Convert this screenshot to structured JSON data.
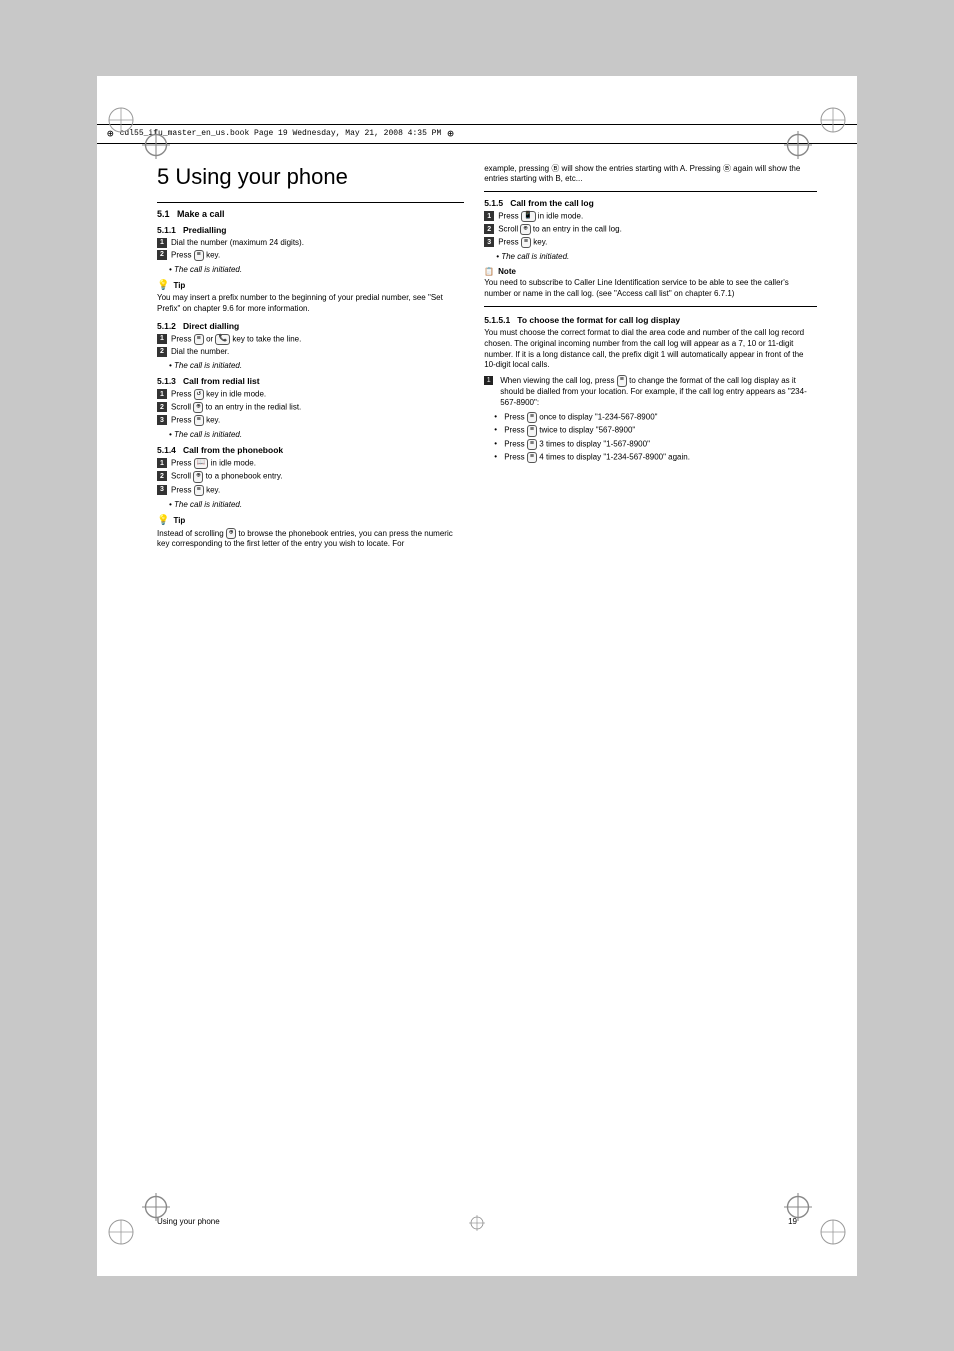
{
  "page": {
    "header_filename": "cdl55_ifu_master_en_us.book   Page 19   Wednesday, May 21, 2008   4:35 PM",
    "chapter_num": "5",
    "chapter_title": "Using your phone",
    "footer_left": "Using your phone",
    "footer_right": "19"
  },
  "left": {
    "section_1_label": "5.1",
    "section_1_title": "Make a call",
    "section_11_label": "5.1.1",
    "section_11_title": "Predialling",
    "section_11_steps": [
      "Dial the number (maximum 24 digits).",
      "Press ≡ key."
    ],
    "section_11_italic": "The call is initiated.",
    "tip1_label": "Tip",
    "tip1_text": "You may insert a prefix number to the beginning of your predial number, see \"Set Prefix\" on chapter 9.6 for more information.",
    "section_12_label": "5.1.2",
    "section_12_title": "Direct dialling",
    "section_12_steps": [
      "Press ≡ or 📞 key to take the line.",
      "Dial the number."
    ],
    "section_12_italic": "The call is initiated.",
    "section_13_label": "5.1.3",
    "section_13_title": "Call from redial list",
    "section_13_steps": [
      "Press ↺ key in idle mode.",
      "Scroll ⊕ to an entry in the redial list.",
      "Press ≡ key."
    ],
    "section_13_italic": "The call is initiated.",
    "section_14_label": "5.1.4",
    "section_14_title": "Call from the phonebook",
    "section_14_steps": [
      "Press 📒 in idle mode.",
      "Scroll ⊕ to a phonebook entry.",
      "Press ≡ key."
    ],
    "section_14_italic": "The call is initiated.",
    "tip2_label": "Tip",
    "tip2_text": "Instead of scrolling ⊕ to browse the phonebook entries, you can press the numeric key corresponding to the first letter of the entry you wish to locate. For",
    "top_right_text": "example, pressing Ⓑ will show the entries starting with A. Pressing Ⓑ again will show the entries starting with B, etc..."
  },
  "right": {
    "section_15_label": "5.1.5",
    "section_15_title": "Call from the call log",
    "section_15_steps": [
      "Press 📱 in idle mode.",
      "Scroll ⊕ to an entry in the call log.",
      "Press ≡ key."
    ],
    "section_15_italic": "The call is initiated.",
    "note_label": "Note",
    "note_text": "You need to subscribe to Caller Line Identification service to be able to see the caller's number or name in the call log. (see \"Access call list\" on chapter 6.7.1)",
    "section_151_label": "5.1.5.1",
    "section_151_title": "To choose the format for call log display",
    "section_151_body1": "You must choose the correct format to dial the area code and number of the call log record chosen. The original incoming number from the call log will appear as a 7, 10 or 11-digit number. If it is a long distance call, the prefix digit 1 will automatically appear in front of the 10-digit local calls.",
    "section_151_steps": [
      "When viewing the call log, press ≡ to change the format of the call log display as it should be dialled from your location. For example, if the call log entry appears as \"234-567-8900\":"
    ],
    "bullet_items": [
      "Press ≡ once to display \"1-234-567-8900\"",
      "Press ≡ twice to display \"567-8900\"",
      "Press ≡ 3 times to display \"1-567-8900\"",
      "Press ≡ 4 times to display \"1-234-567-8900\" again."
    ]
  }
}
